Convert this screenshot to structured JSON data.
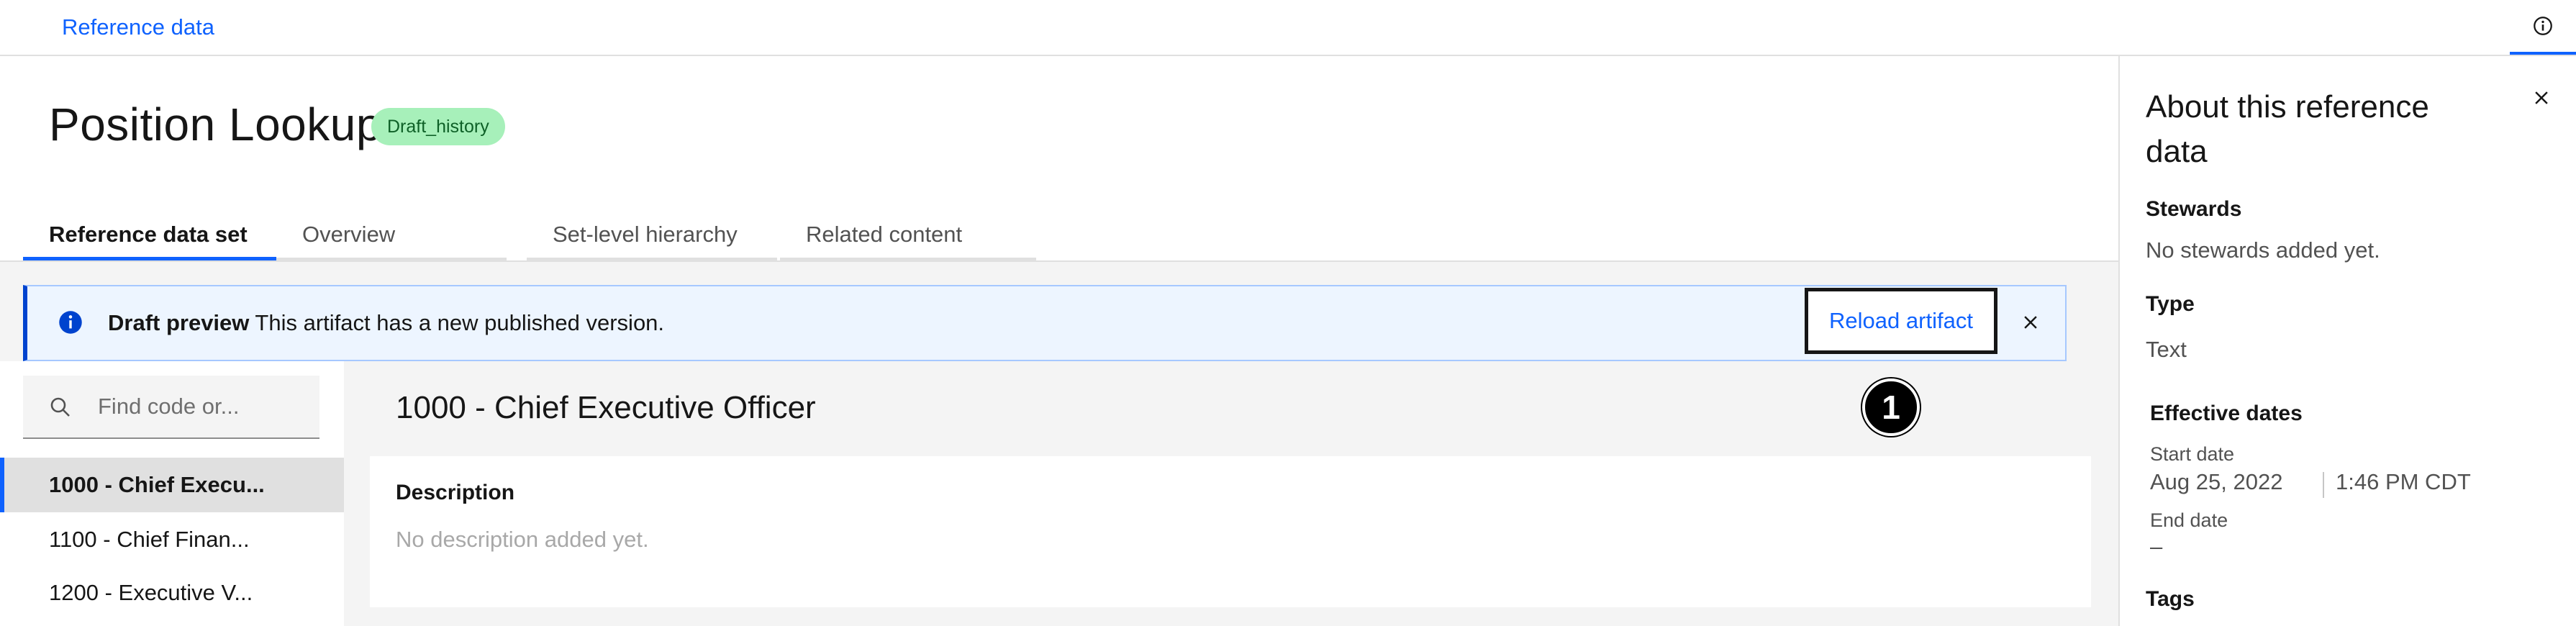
{
  "topbar": {
    "breadcrumb": "Reference data",
    "info_icon": "info-icon"
  },
  "header": {
    "title": "Position Lookup",
    "badge": "Draft_history"
  },
  "tabs": [
    {
      "label": "Reference data set",
      "active": true
    },
    {
      "label": "Overview",
      "active": false
    },
    {
      "label": "Set-level hierarchy",
      "active": false
    },
    {
      "label": "Related content",
      "active": false
    }
  ],
  "notification": {
    "title": "Draft preview",
    "message": "This artifact has a new published version.",
    "action": "Reload artifact",
    "icon": "info-filled-icon"
  },
  "search": {
    "placeholder": "Find code or...",
    "icon": "search-icon"
  },
  "list": {
    "items": [
      {
        "label": "1000 - Chief Execu...",
        "selected": true
      },
      {
        "label": "1100 - Chief Finan...",
        "selected": false
      },
      {
        "label": "1200 - Executive V...",
        "selected": false
      }
    ]
  },
  "detail": {
    "title": "1000 - Chief Executive Officer",
    "description_label": "Description",
    "description_value": "No description added yet."
  },
  "step_marker": "1",
  "side_panel": {
    "title": "About this reference data",
    "stewards_label": "Stewards",
    "stewards_value": "No stewards added yet.",
    "type_label": "Type",
    "type_value": "Text",
    "effective_dates_label": "Effective dates",
    "start_date_label": "Start date",
    "start_date": "Aug 25, 2022",
    "start_time": "1:46 PM CDT",
    "end_date_label": "End date",
    "end_date": "–",
    "tags_label": "Tags"
  },
  "colors": {
    "accent": "#0f62fe",
    "badge_bg": "#a7f0ba",
    "badge_text": "#0e6027",
    "notification_bg": "#edf5ff",
    "notification_border": "#0043ce"
  }
}
